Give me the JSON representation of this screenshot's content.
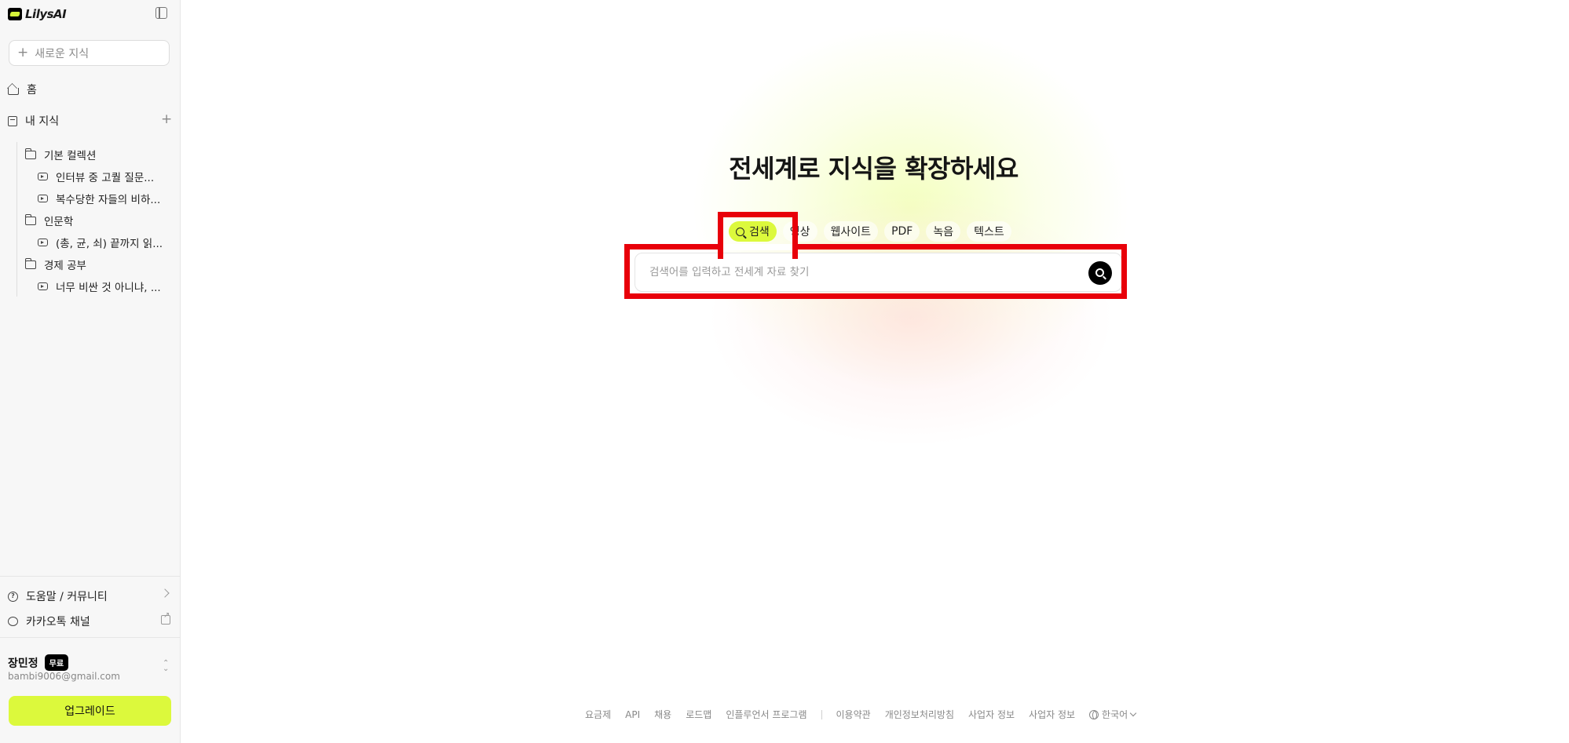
{
  "brand": {
    "name": "LilysAI"
  },
  "sidebar": {
    "new_knowledge_placeholder": "새로운 지식",
    "nav": [
      {
        "label": "홈",
        "icon": "home-icon"
      },
      {
        "label": "내 지식",
        "icon": "book-icon"
      }
    ],
    "tree": [
      {
        "type": "folder",
        "label": "기본 컬렉션"
      },
      {
        "type": "video",
        "label": "인터뷰 중 고퀄 질문..."
      },
      {
        "type": "video",
        "label": "복수당한 자들의 비하..."
      },
      {
        "type": "folder",
        "label": "인문학"
      },
      {
        "type": "video",
        "label": "(총, 균, 쇠) 끝까지 읽..."
      },
      {
        "type": "folder",
        "label": "경제 공부"
      },
      {
        "type": "video",
        "label": "너무 비싼 것 아니냐, ..."
      }
    ],
    "help_label": "도움말 / 커뮤니티",
    "kakao_label": "카카오톡 채널",
    "user": {
      "name": "장민정",
      "plan": "무료",
      "email": "bambi9006@gmail.com"
    },
    "upgrade_label": "업그레이드"
  },
  "main": {
    "headline": "전세계로 지식을 확장하세요",
    "tabs": [
      {
        "label": "검색",
        "active": true
      },
      {
        "label": "영상",
        "active": false
      },
      {
        "label": "웹사이트",
        "active": false
      },
      {
        "label": "PDF",
        "active": false
      },
      {
        "label": "녹음",
        "active": false
      },
      {
        "label": "텍스트",
        "active": false
      }
    ],
    "search_placeholder": "검색어를 입력하고 전세계 자료 찾기"
  },
  "footer": {
    "links_left": [
      "요금제",
      "API",
      "채용",
      "로드맵",
      "인플루언서 프로그램"
    ],
    "links_right": [
      "이용약관",
      "개인정보처리방침",
      "사업자 정보",
      "사업자 정보"
    ],
    "language": "한국어"
  },
  "colors": {
    "accent": "#dcf93c",
    "highlight": "#e8000a"
  }
}
